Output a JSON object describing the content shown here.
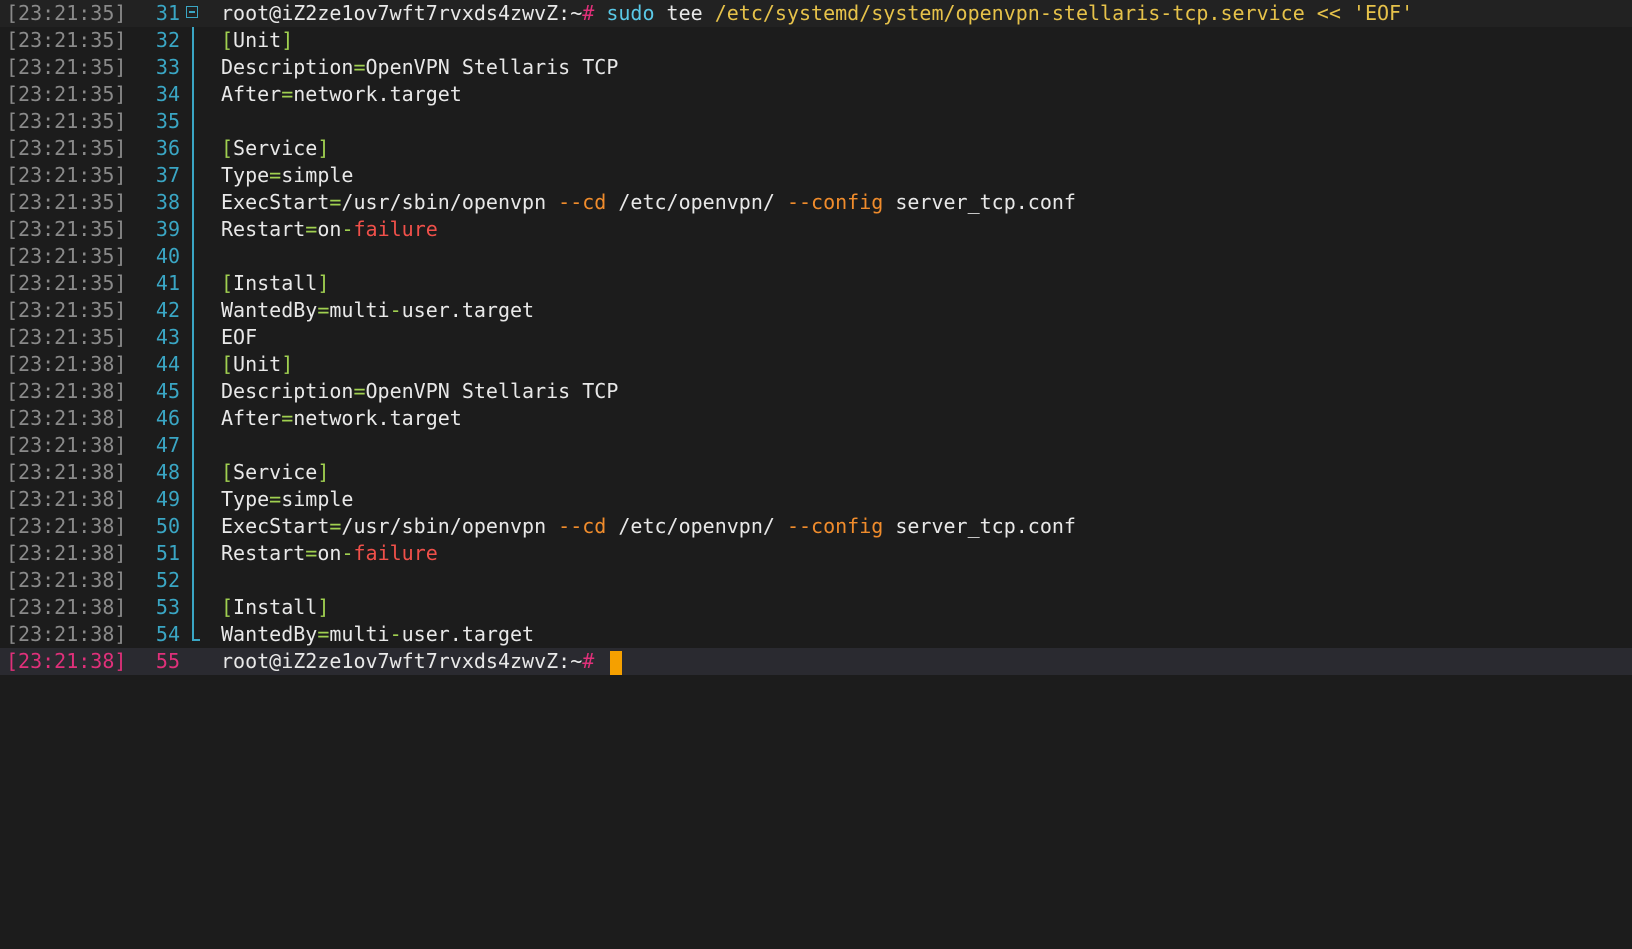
{
  "terminal": {
    "prompt": "root@iZ2ze1ov7wft7rvxds4zwvZ:~",
    "prompt_symbol": "#",
    "command": {
      "name": "sudo",
      "sub": "tee",
      "path": "/etc/systemd/system/openvpn-stellaris-tcp.service",
      "redir": "<<",
      "delim": "'EOF'"
    },
    "lines": [
      {
        "ts": "[23:21:35]",
        "n": "31"
      },
      {
        "ts": "[23:21:35]",
        "n": "32",
        "b1": "Unit"
      },
      {
        "ts": "[23:21:35]",
        "n": "33",
        "k": "Description",
        "v": "OpenVPN Stellaris TCP"
      },
      {
        "ts": "[23:21:35]",
        "n": "34",
        "k": "After",
        "v": "network.target"
      },
      {
        "ts": "[23:21:35]",
        "n": "35"
      },
      {
        "ts": "[23:21:35]",
        "n": "36",
        "b1": "Service"
      },
      {
        "ts": "[23:21:35]",
        "n": "37",
        "k": "Type",
        "v": "simple"
      },
      {
        "ts": "[23:21:35]",
        "n": "38",
        "k": "ExecStart",
        "v1": "/usr/sbin/openvpn ",
        "f1": "--cd",
        "v2": " /etc/openvpn/ ",
        "f2": "--config",
        "v3": " server_tcp.conf"
      },
      {
        "ts": "[23:21:35]",
        "n": "39",
        "k": "Restart",
        "r1": "on",
        "r2": "failure"
      },
      {
        "ts": "[23:21:35]",
        "n": "40"
      },
      {
        "ts": "[23:21:35]",
        "n": "41",
        "b1": "Install"
      },
      {
        "ts": "[23:21:35]",
        "n": "42",
        "k": "WantedBy",
        "w1": "multi",
        "w2": "user.target"
      },
      {
        "ts": "[23:21:35]",
        "n": "43",
        "plain": "EOF"
      },
      {
        "ts": "[23:21:38]",
        "n": "44",
        "b1": "Unit"
      },
      {
        "ts": "[23:21:38]",
        "n": "45",
        "k": "Description",
        "v": "OpenVPN Stellaris TCP"
      },
      {
        "ts": "[23:21:38]",
        "n": "46",
        "k": "After",
        "v": "network.target"
      },
      {
        "ts": "[23:21:38]",
        "n": "47"
      },
      {
        "ts": "[23:21:38]",
        "n": "48",
        "b1": "Service"
      },
      {
        "ts": "[23:21:38]",
        "n": "49",
        "k": "Type",
        "v": "simple"
      },
      {
        "ts": "[23:21:38]",
        "n": "50",
        "k": "ExecStart",
        "v1": "/usr/sbin/openvpn ",
        "f1": "--cd",
        "v2": " /etc/openvpn/ ",
        "f2": "--config",
        "v3": " server_tcp.conf"
      },
      {
        "ts": "[23:21:38]",
        "n": "51",
        "k": "Restart",
        "r1": "on",
        "r2": "failure"
      },
      {
        "ts": "[23:21:38]",
        "n": "52"
      },
      {
        "ts": "[23:21:38]",
        "n": "53",
        "b1": "Install"
      },
      {
        "ts": "[23:21:38]",
        "n": "54",
        "k": "WantedBy",
        "w1": "multi",
        "w2": "user.target"
      },
      {
        "ts": "[23:21:38]",
        "n": "55"
      }
    ],
    "symbols": {
      "eq": "=",
      "dash": "-",
      "lbr": "[",
      "rbr": "]"
    }
  },
  "colors": {
    "background": "#1c1c1c",
    "line_number": "#3aa6c4",
    "current_line": "#e0307a",
    "cursor": "#f5a000"
  },
  "icons": {
    "fold": "fold-collapse-icon",
    "cursor": "cursor-block"
  }
}
